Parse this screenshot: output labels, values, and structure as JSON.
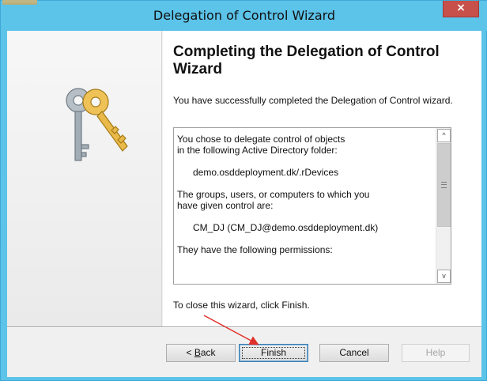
{
  "window": {
    "title": "Delegation of Control Wizard",
    "close_symbol": "×"
  },
  "page": {
    "heading": "Completing the Delegation of Control Wizard",
    "intro": "You have successfully completed the Delegation of Control wizard.",
    "summary_lines": [
      "You chose to delegate control of objects",
      "in the following Active Directory folder:",
      "",
      "      demo.osddeployment.dk/.rDevices",
      "",
      "The groups, users, or computers to which you",
      "have given control are:",
      "",
      "      CM_DJ (CM_DJ@demo.osddeployment.dk)",
      "",
      "They have the following permissions:"
    ],
    "closing": "To close this wizard, click Finish."
  },
  "scrollbar": {
    "up_symbol": "^",
    "down_symbol": "v"
  },
  "buttons": {
    "back_prefix": "< ",
    "back_accel": "B",
    "back_rest": "ack",
    "finish": "Finish",
    "cancel": "Cancel",
    "help": "Help"
  },
  "colors": {
    "title_bar": "#5cc3e9",
    "close_button": "#c7504a",
    "annotation_arrow": "#e0302a",
    "key_gold": "#e9b94a",
    "key_silver": "#9aa3ab"
  },
  "icons": {
    "wizard_graphic": "keys-icon",
    "close": "close-icon"
  }
}
